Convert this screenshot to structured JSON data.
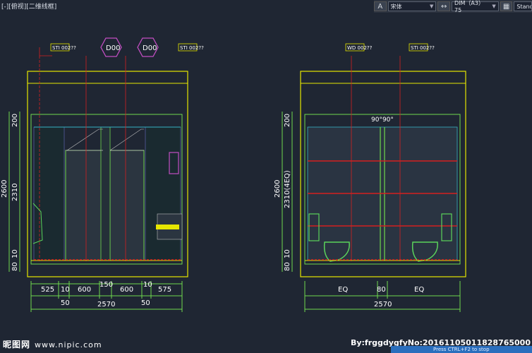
{
  "viewport_label": "[-][俯视][二维线框]",
  "toolbar": {
    "text_style_icon": "text-style-icon",
    "font_value": "宋体",
    "dim_icon": "dimension-icon",
    "dim_value": "DIM（A3）75",
    "table_icon": "table-style-icon",
    "table_value": "Standa"
  },
  "left_elevation": {
    "tags": [
      "STI 002??",
      "D00",
      "D00",
      "STI 002??"
    ],
    "dims_top": [
      "525",
      "10",
      "600",
      "150",
      "600",
      "10",
      "575"
    ],
    "dims_mid": [
      "50",
      "50"
    ],
    "dims_total": "2570",
    "dims_vertical": [
      "2600",
      "2310",
      "200",
      "10",
      "80"
    ]
  },
  "right_elevation": {
    "tags": [
      "WD 002??",
      "STI 002??"
    ],
    "angle_note": "90°90°",
    "dims_top": [
      "EQ",
      "80",
      "EQ"
    ],
    "dims_total": "2570",
    "dims_vertical": [
      "2600",
      "2310(4EQ)",
      "200",
      "10",
      "80"
    ]
  },
  "watermark": {
    "site": "昵图网",
    "url": "www.nipic.com",
    "credit": "By:frggdygfyNo:20161105011828765000"
  },
  "status_hint": "Press CTRL+F2 to stop"
}
